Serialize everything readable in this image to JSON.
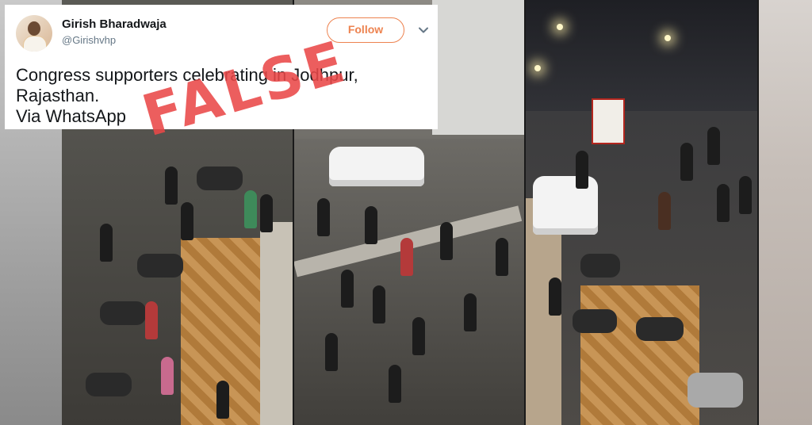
{
  "tweet": {
    "author_name": "Girish Bharadwaja",
    "author_handle": "@Girishvhp",
    "follow_label": "Follow",
    "text_lines": [
      "Congress supporters celebrating in Jodhpur,",
      "Rajasthan.",
      "Via WhatsApp"
    ]
  },
  "stamp": {
    "label": "FALSE",
    "color": "#e94848"
  },
  "panels": {
    "count": 3,
    "scene": "night street crowd video stills"
  },
  "icons": {
    "more_menu": "chevron-down-icon"
  }
}
